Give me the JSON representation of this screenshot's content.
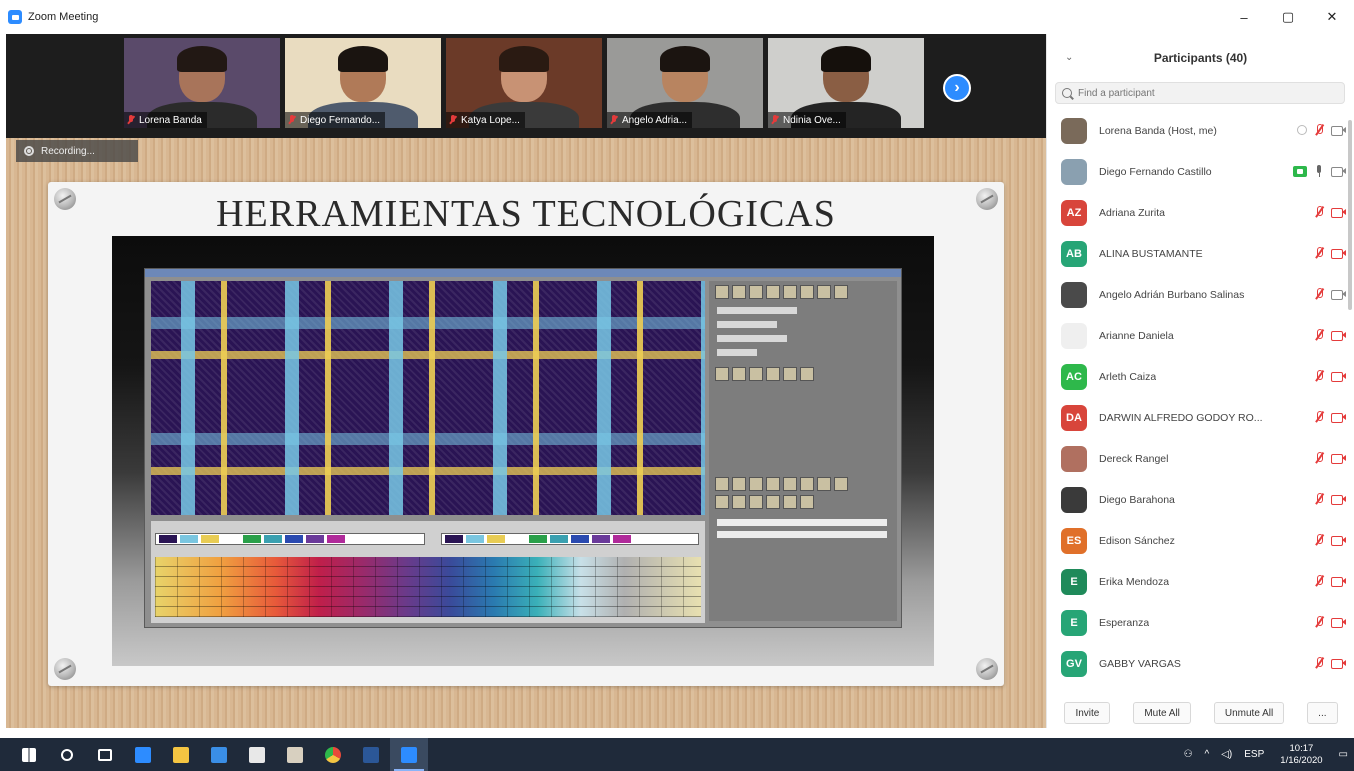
{
  "window": {
    "title": "Zoom Meeting",
    "minimize": "–",
    "maximize": "▢",
    "close": "✕"
  },
  "thumbnails": [
    {
      "name": "Lorena Banda",
      "bg": "#5a4a6a",
      "skin": "#a8745a",
      "hair": "#221814",
      "shirt": "#2b2b2b"
    },
    {
      "name": "Diego Fernando...",
      "bg": "#e9dcc0",
      "skin": "#b07a58",
      "hair": "#1a1410",
      "shirt": "#4f5b6d"
    },
    {
      "name": "Katya Lope...",
      "bg": "#6b3a28",
      "skin": "#c89274",
      "hair": "#2a1a12",
      "shirt": "#3a3a3a"
    },
    {
      "name": "Angelo Adria...",
      "bg": "#9a9a98",
      "skin": "#b88460",
      "hair": "#1b1410",
      "shirt": "#2e2e2e"
    },
    {
      "name": "Ndinia Ove...",
      "bg": "#cfcfcc",
      "skin": "#8a5e44",
      "hair": "#15100c",
      "shirt": "#242424"
    }
  ],
  "recording": {
    "label": "Recording..."
  },
  "slide": {
    "title": "HERRAMIENTAS TECNOLÓGICAS"
  },
  "panel": {
    "title": "Participants (40)",
    "search_placeholder": "Find a participant",
    "footer": {
      "invite": "Invite",
      "mute_all": "Mute All",
      "unmute_all": "Unmute All",
      "more": "..."
    }
  },
  "participants": [
    {
      "name": "Lorena Banda (Host, me)",
      "initials": "",
      "avatar_color": "#7a6a5a",
      "mic": "muted",
      "cam": "gray",
      "extra": "record"
    },
    {
      "name": "Diego Fernando Castillo",
      "initials": "",
      "avatar_color": "#8aa0b0",
      "mic": "on",
      "cam": "gray",
      "extra": "share"
    },
    {
      "name": "Adriana Zurita",
      "initials": "AZ",
      "avatar_color": "#d8453b",
      "mic": "muted",
      "cam": "off"
    },
    {
      "name": "ALINA BUSTAMANTE",
      "initials": "AB",
      "avatar_color": "#27a576",
      "mic": "muted",
      "cam": "off"
    },
    {
      "name": "Angelo Adrián Burbano Salinas",
      "initials": "",
      "avatar_color": "#4a4a4a",
      "mic": "muted",
      "cam": "gray"
    },
    {
      "name": "Arianne Daniela",
      "initials": "",
      "avatar_color": "#efefef",
      "mic": "muted",
      "cam": "off"
    },
    {
      "name": "Arleth Caiza",
      "initials": "AC",
      "avatar_color": "#2eb84b",
      "mic": "muted",
      "cam": "off"
    },
    {
      "name": "DARWIN ALFREDO GODOY RO...",
      "initials": "DA",
      "avatar_color": "#d8453b",
      "mic": "muted",
      "cam": "off"
    },
    {
      "name": "Dereck Rangel",
      "initials": "",
      "avatar_color": "#b07060",
      "mic": "muted",
      "cam": "off"
    },
    {
      "name": "Diego Barahona",
      "initials": "",
      "avatar_color": "#3a3a3a",
      "mic": "muted",
      "cam": "off"
    },
    {
      "name": "Edison Sánchez",
      "initials": "ES",
      "avatar_color": "#e0702a",
      "mic": "muted",
      "cam": "off"
    },
    {
      "name": "Erika Mendoza",
      "initials": "E",
      "avatar_color": "#1f8a5a",
      "mic": "muted",
      "cam": "off"
    },
    {
      "name": "Esperanza",
      "initials": "E",
      "avatar_color": "#27a576",
      "mic": "muted",
      "cam": "off"
    },
    {
      "name": "GABBY VARGAS",
      "initials": "GV",
      "avatar_color": "#27a576",
      "mic": "muted",
      "cam": "off"
    }
  ],
  "taskbar": {
    "apps": [
      {
        "name": "start-icon",
        "color": "#ffffff"
      },
      {
        "name": "search-icon",
        "color": "#ffffff"
      },
      {
        "name": "task-view-icon",
        "color": "#ffffff"
      },
      {
        "name": "edge-icon",
        "color": "#2d8cff"
      },
      {
        "name": "file-explorer-icon",
        "color": "#f4c542"
      },
      {
        "name": "mail-icon",
        "color": "#3a8ee6"
      },
      {
        "name": "store-icon",
        "color": "#e8e8e8"
      },
      {
        "name": "app-icon",
        "color": "#d8d0c0"
      },
      {
        "name": "chrome-icon",
        "color": "#e84a3a"
      },
      {
        "name": "word-icon",
        "color": "#2b5797"
      },
      {
        "name": "zoom-icon",
        "color": "#2d8cff"
      }
    ],
    "language": "ESP",
    "time": "10:17",
    "date": "1/16/2020"
  }
}
